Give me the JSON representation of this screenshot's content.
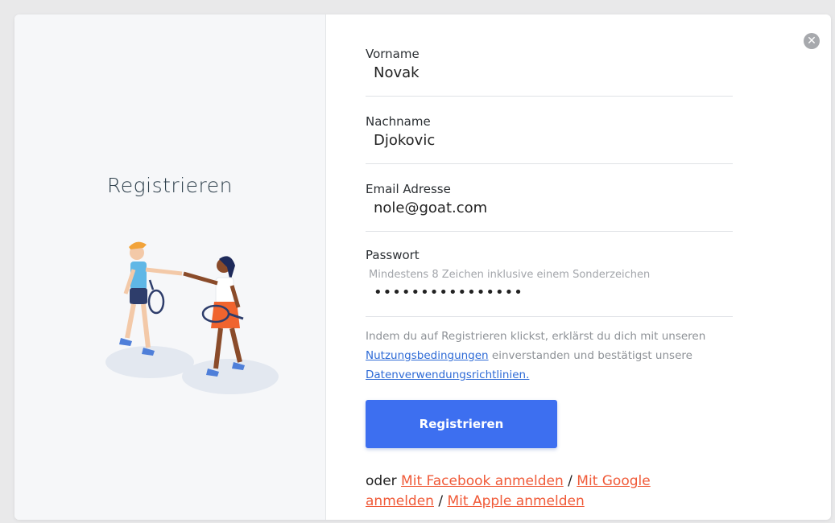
{
  "left": {
    "title": "Registrieren"
  },
  "close": {
    "icon": "close-icon",
    "glyph": "✕"
  },
  "form": {
    "first_name": {
      "label": "Vorname",
      "value": "Novak"
    },
    "last_name": {
      "label": "Nachname",
      "value": "Djokovic"
    },
    "email": {
      "label": "Email Adresse",
      "value": "nole@goat.com"
    },
    "password": {
      "label": "Passwort",
      "hint": "Mindestens 8 Zeichen inklusive einem Sonderzeichen",
      "masked_value": "••••••••••••••••"
    }
  },
  "legal": {
    "text_1": "Indem du auf Registrieren klickst, erklärst du dich mit unseren ",
    "terms_link": "Nutzungsbedingungen",
    "text_2": " einverstanden und bestätigst unsere ",
    "privacy_link": "Datenverwendungsrichtlinien."
  },
  "submit": {
    "label": "Registrieren"
  },
  "social": {
    "prefix": "oder ",
    "facebook": "Mit Facebook anmelden",
    "sep_1": " / ",
    "google": "Mit Google anmelden",
    "sep_2": " / ",
    "apple": "Mit Apple anmelden"
  },
  "colors": {
    "primary": "#3d6ff0",
    "link": "#2d6ad6",
    "social_link": "#f05a38",
    "panel_bg": "#f6f7f9"
  }
}
